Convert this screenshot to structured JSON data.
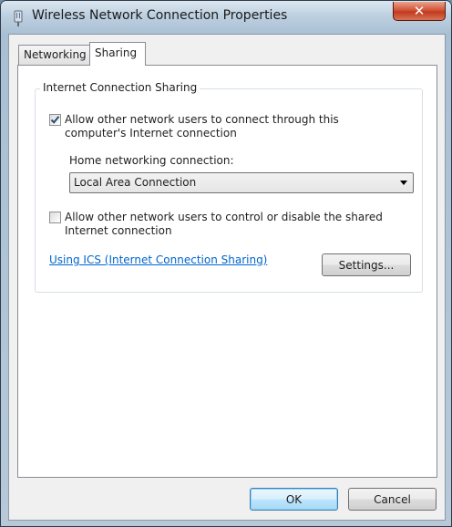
{
  "window": {
    "title": "Wireless Network Connection Properties",
    "close_symbol": "✕",
    "icon": "network-adapter-icon"
  },
  "tabs": [
    {
      "label": "Networking",
      "selected": false
    },
    {
      "label": "Sharing",
      "selected": true
    }
  ],
  "sharing": {
    "group_title": "Internet Connection Sharing",
    "allow_connect": {
      "checked": true,
      "label": "Allow other network users to connect through this computer's Internet connection"
    },
    "home_connection_label": "Home networking connection:",
    "home_connection_value": "Local Area Connection",
    "allow_control": {
      "checked": false,
      "label": "Allow other network users to control or disable the shared Internet connection"
    },
    "help_link": "Using ICS (Internet Connection Sharing)",
    "settings_button": "Settings..."
  },
  "footer": {
    "ok": "OK",
    "cancel": "Cancel"
  },
  "colors": {
    "link": "#0066cc",
    "close_button": "#c23a1c",
    "checkmark": "#2b4a70"
  }
}
